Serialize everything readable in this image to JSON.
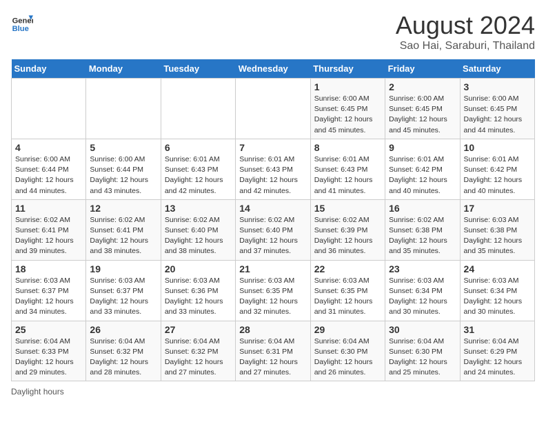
{
  "header": {
    "logo_line1": "General",
    "logo_line2": "Blue",
    "main_title": "August 2024",
    "subtitle": "Sao Hai, Saraburi, Thailand"
  },
  "weekdays": [
    "Sunday",
    "Monday",
    "Tuesday",
    "Wednesday",
    "Thursday",
    "Friday",
    "Saturday"
  ],
  "weeks": [
    [
      {
        "day": "",
        "info": ""
      },
      {
        "day": "",
        "info": ""
      },
      {
        "day": "",
        "info": ""
      },
      {
        "day": "",
        "info": ""
      },
      {
        "day": "1",
        "info": "Sunrise: 6:00 AM\nSunset: 6:45 PM\nDaylight: 12 hours\nand 45 minutes."
      },
      {
        "day": "2",
        "info": "Sunrise: 6:00 AM\nSunset: 6:45 PM\nDaylight: 12 hours\nand 45 minutes."
      },
      {
        "day": "3",
        "info": "Sunrise: 6:00 AM\nSunset: 6:45 PM\nDaylight: 12 hours\nand 44 minutes."
      }
    ],
    [
      {
        "day": "4",
        "info": "Sunrise: 6:00 AM\nSunset: 6:44 PM\nDaylight: 12 hours\nand 44 minutes."
      },
      {
        "day": "5",
        "info": "Sunrise: 6:00 AM\nSunset: 6:44 PM\nDaylight: 12 hours\nand 43 minutes."
      },
      {
        "day": "6",
        "info": "Sunrise: 6:01 AM\nSunset: 6:43 PM\nDaylight: 12 hours\nand 42 minutes."
      },
      {
        "day": "7",
        "info": "Sunrise: 6:01 AM\nSunset: 6:43 PM\nDaylight: 12 hours\nand 42 minutes."
      },
      {
        "day": "8",
        "info": "Sunrise: 6:01 AM\nSunset: 6:43 PM\nDaylight: 12 hours\nand 41 minutes."
      },
      {
        "day": "9",
        "info": "Sunrise: 6:01 AM\nSunset: 6:42 PM\nDaylight: 12 hours\nand 40 minutes."
      },
      {
        "day": "10",
        "info": "Sunrise: 6:01 AM\nSunset: 6:42 PM\nDaylight: 12 hours\nand 40 minutes."
      }
    ],
    [
      {
        "day": "11",
        "info": "Sunrise: 6:02 AM\nSunset: 6:41 PM\nDaylight: 12 hours\nand 39 minutes."
      },
      {
        "day": "12",
        "info": "Sunrise: 6:02 AM\nSunset: 6:41 PM\nDaylight: 12 hours\nand 38 minutes."
      },
      {
        "day": "13",
        "info": "Sunrise: 6:02 AM\nSunset: 6:40 PM\nDaylight: 12 hours\nand 38 minutes."
      },
      {
        "day": "14",
        "info": "Sunrise: 6:02 AM\nSunset: 6:40 PM\nDaylight: 12 hours\nand 37 minutes."
      },
      {
        "day": "15",
        "info": "Sunrise: 6:02 AM\nSunset: 6:39 PM\nDaylight: 12 hours\nand 36 minutes."
      },
      {
        "day": "16",
        "info": "Sunrise: 6:02 AM\nSunset: 6:38 PM\nDaylight: 12 hours\nand 35 minutes."
      },
      {
        "day": "17",
        "info": "Sunrise: 6:03 AM\nSunset: 6:38 PM\nDaylight: 12 hours\nand 35 minutes."
      }
    ],
    [
      {
        "day": "18",
        "info": "Sunrise: 6:03 AM\nSunset: 6:37 PM\nDaylight: 12 hours\nand 34 minutes."
      },
      {
        "day": "19",
        "info": "Sunrise: 6:03 AM\nSunset: 6:37 PM\nDaylight: 12 hours\nand 33 minutes."
      },
      {
        "day": "20",
        "info": "Sunrise: 6:03 AM\nSunset: 6:36 PM\nDaylight: 12 hours\nand 33 minutes."
      },
      {
        "day": "21",
        "info": "Sunrise: 6:03 AM\nSunset: 6:35 PM\nDaylight: 12 hours\nand 32 minutes."
      },
      {
        "day": "22",
        "info": "Sunrise: 6:03 AM\nSunset: 6:35 PM\nDaylight: 12 hours\nand 31 minutes."
      },
      {
        "day": "23",
        "info": "Sunrise: 6:03 AM\nSunset: 6:34 PM\nDaylight: 12 hours\nand 30 minutes."
      },
      {
        "day": "24",
        "info": "Sunrise: 6:03 AM\nSunset: 6:34 PM\nDaylight: 12 hours\nand 30 minutes."
      }
    ],
    [
      {
        "day": "25",
        "info": "Sunrise: 6:04 AM\nSunset: 6:33 PM\nDaylight: 12 hours\nand 29 minutes."
      },
      {
        "day": "26",
        "info": "Sunrise: 6:04 AM\nSunset: 6:32 PM\nDaylight: 12 hours\nand 28 minutes."
      },
      {
        "day": "27",
        "info": "Sunrise: 6:04 AM\nSunset: 6:32 PM\nDaylight: 12 hours\nand 27 minutes."
      },
      {
        "day": "28",
        "info": "Sunrise: 6:04 AM\nSunset: 6:31 PM\nDaylight: 12 hours\nand 27 minutes."
      },
      {
        "day": "29",
        "info": "Sunrise: 6:04 AM\nSunset: 6:30 PM\nDaylight: 12 hours\nand 26 minutes."
      },
      {
        "day": "30",
        "info": "Sunrise: 6:04 AM\nSunset: 6:30 PM\nDaylight: 12 hours\nand 25 minutes."
      },
      {
        "day": "31",
        "info": "Sunrise: 6:04 AM\nSunset: 6:29 PM\nDaylight: 12 hours\nand 24 minutes."
      }
    ]
  ],
  "footer": {
    "note": "Daylight hours"
  }
}
